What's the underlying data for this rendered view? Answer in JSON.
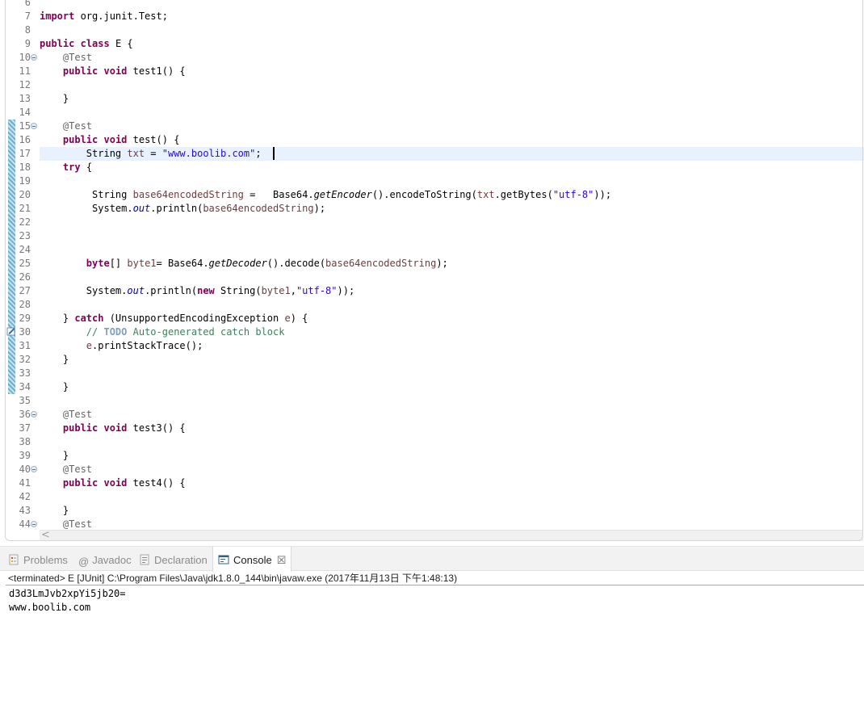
{
  "editor": {
    "lines": [
      {
        "number": "6",
        "tokens": []
      },
      {
        "number": "7",
        "tokens": [
          {
            "t": "kw",
            "v": "import"
          },
          {
            "t": "pl",
            "v": " org.junit.Test;"
          }
        ]
      },
      {
        "number": "8",
        "tokens": []
      },
      {
        "number": "9",
        "tokens": [
          {
            "t": "kw",
            "v": "public"
          },
          {
            "t": "pl",
            "v": " "
          },
          {
            "t": "kw",
            "v": "class"
          },
          {
            "t": "pl",
            "v": " E {"
          }
        ]
      },
      {
        "number": "10",
        "fold": true,
        "tokens": [
          {
            "t": "pl",
            "v": "    "
          },
          {
            "t": "ann",
            "v": "@Test"
          }
        ]
      },
      {
        "number": "11",
        "tokens": [
          {
            "t": "pl",
            "v": "    "
          },
          {
            "t": "kw",
            "v": "public"
          },
          {
            "t": "pl",
            "v": " "
          },
          {
            "t": "kw",
            "v": "void"
          },
          {
            "t": "pl",
            "v": " test1() {"
          }
        ]
      },
      {
        "number": "12",
        "tokens": []
      },
      {
        "number": "13",
        "tokens": [
          {
            "t": "pl",
            "v": "    }"
          }
        ]
      },
      {
        "number": "14",
        "tokens": []
      },
      {
        "number": "15",
        "fold": true,
        "changed": true,
        "tokens": [
          {
            "t": "pl",
            "v": "    "
          },
          {
            "t": "ann",
            "v": "@Test"
          }
        ]
      },
      {
        "number": "16",
        "changed": true,
        "tokens": [
          {
            "t": "pl",
            "v": "    "
          },
          {
            "t": "kw",
            "v": "public"
          },
          {
            "t": "pl",
            "v": " "
          },
          {
            "t": "kw",
            "v": "void"
          },
          {
            "t": "pl",
            "v": " test() {"
          }
        ]
      },
      {
        "number": "17",
        "changed": true,
        "current": true,
        "tokens": [
          {
            "t": "pl",
            "v": "        String "
          },
          {
            "t": "lv",
            "v": "txt"
          },
          {
            "t": "pl",
            "v": " = "
          },
          {
            "t": "str",
            "v": "\"www.boolib.com\""
          },
          {
            "t": "pl",
            "v": ";"
          }
        ]
      },
      {
        "number": "18",
        "changed": true,
        "tokens": [
          {
            "t": "pl",
            "v": "    "
          },
          {
            "t": "kw",
            "v": "try"
          },
          {
            "t": "pl",
            "v": " {"
          }
        ]
      },
      {
        "number": "19",
        "changed": true,
        "tokens": []
      },
      {
        "number": "20",
        "changed": true,
        "tokens": [
          {
            "t": "pl",
            "v": "         String "
          },
          {
            "t": "lv",
            "v": "base64encodedString"
          },
          {
            "t": "pl",
            "v": " =   Base64."
          },
          {
            "t": "smi",
            "v": "getEncoder"
          },
          {
            "t": "pl",
            "v": "().encodeToString("
          },
          {
            "t": "lv",
            "v": "txt"
          },
          {
            "t": "pl",
            "v": ".getBytes("
          },
          {
            "t": "str",
            "v": "\"utf-8\""
          },
          {
            "t": "pl",
            "v": "));"
          }
        ]
      },
      {
        "number": "21",
        "changed": true,
        "tokens": [
          {
            "t": "pl",
            "v": "         System."
          },
          {
            "t": "fld",
            "v": "out"
          },
          {
            "t": "pl",
            "v": ".println("
          },
          {
            "t": "lv",
            "v": "base64encodedString"
          },
          {
            "t": "pl",
            "v": ");"
          }
        ]
      },
      {
        "number": "22",
        "changed": true,
        "tokens": []
      },
      {
        "number": "23",
        "changed": true,
        "tokens": []
      },
      {
        "number": "24",
        "changed": true,
        "tokens": []
      },
      {
        "number": "25",
        "changed": true,
        "tokens": [
          {
            "t": "pl",
            "v": "        "
          },
          {
            "t": "kw",
            "v": "byte"
          },
          {
            "t": "pl",
            "v": "[] "
          },
          {
            "t": "lv",
            "v": "byte1"
          },
          {
            "t": "pl",
            "v": "= Base64."
          },
          {
            "t": "smi",
            "v": "getDecoder"
          },
          {
            "t": "pl",
            "v": "().decode("
          },
          {
            "t": "lv",
            "v": "base64encodedString"
          },
          {
            "t": "pl",
            "v": ");"
          }
        ]
      },
      {
        "number": "26",
        "changed": true,
        "tokens": []
      },
      {
        "number": "27",
        "changed": true,
        "tokens": [
          {
            "t": "pl",
            "v": "        System."
          },
          {
            "t": "fld",
            "v": "out"
          },
          {
            "t": "pl",
            "v": ".println("
          },
          {
            "t": "kw",
            "v": "new"
          },
          {
            "t": "pl",
            "v": " String("
          },
          {
            "t": "lv",
            "v": "byte1"
          },
          {
            "t": "pl",
            "v": ","
          },
          {
            "t": "str",
            "v": "\"utf-8\""
          },
          {
            "t": "pl",
            "v": "));"
          }
        ]
      },
      {
        "number": "28",
        "changed": true,
        "tokens": []
      },
      {
        "number": "29",
        "changed": true,
        "tokens": [
          {
            "t": "pl",
            "v": "    } "
          },
          {
            "t": "kw",
            "v": "catch"
          },
          {
            "t": "pl",
            "v": " (UnsupportedEncodingException "
          },
          {
            "t": "lv",
            "v": "e"
          },
          {
            "t": "pl",
            "v": ") {"
          }
        ]
      },
      {
        "number": "30",
        "changed": true,
        "task": true,
        "tokens": [
          {
            "t": "pl",
            "v": "        "
          },
          {
            "t": "cmt",
            "v": "// "
          },
          {
            "t": "todo",
            "v": "TODO"
          },
          {
            "t": "cmt",
            "v": " Auto-generated catch block"
          }
        ]
      },
      {
        "number": "31",
        "changed": true,
        "tokens": [
          {
            "t": "pl",
            "v": "        "
          },
          {
            "t": "lv",
            "v": "e"
          },
          {
            "t": "pl",
            "v": ".printStackTrace();"
          }
        ]
      },
      {
        "number": "32",
        "changed": true,
        "tokens": [
          {
            "t": "pl",
            "v": "    }"
          }
        ]
      },
      {
        "number": "33",
        "changed": true,
        "tokens": []
      },
      {
        "number": "34",
        "changed": true,
        "tokens": [
          {
            "t": "pl",
            "v": "    }"
          }
        ]
      },
      {
        "number": "35",
        "tokens": []
      },
      {
        "number": "36",
        "fold": true,
        "tokens": [
          {
            "t": "pl",
            "v": "    "
          },
          {
            "t": "ann",
            "v": "@Test"
          }
        ]
      },
      {
        "number": "37",
        "tokens": [
          {
            "t": "pl",
            "v": "    "
          },
          {
            "t": "kw",
            "v": "public"
          },
          {
            "t": "pl",
            "v": " "
          },
          {
            "t": "kw",
            "v": "void"
          },
          {
            "t": "pl",
            "v": " test3() {"
          }
        ]
      },
      {
        "number": "38",
        "tokens": []
      },
      {
        "number": "39",
        "tokens": [
          {
            "t": "pl",
            "v": "    }"
          }
        ]
      },
      {
        "number": "40",
        "fold": true,
        "tokens": [
          {
            "t": "pl",
            "v": "    "
          },
          {
            "t": "ann",
            "v": "@Test"
          }
        ]
      },
      {
        "number": "41",
        "tokens": [
          {
            "t": "pl",
            "v": "    "
          },
          {
            "t": "kw",
            "v": "public"
          },
          {
            "t": "pl",
            "v": " "
          },
          {
            "t": "kw",
            "v": "void"
          },
          {
            "t": "pl",
            "v": " test4() {"
          }
        ]
      },
      {
        "number": "42",
        "tokens": []
      },
      {
        "number": "43",
        "tokens": [
          {
            "t": "pl",
            "v": "    }"
          }
        ]
      },
      {
        "number": "44",
        "fold": true,
        "tokens": [
          {
            "t": "pl",
            "v": "    "
          },
          {
            "t": "ann",
            "v": "@Test"
          }
        ]
      }
    ],
    "scroll_left_label": "<"
  },
  "panel": {
    "tabs": [
      {
        "label": "Problems",
        "icon": "problems-icon",
        "active": false
      },
      {
        "label": "Javadoc",
        "icon": "at-sign-icon",
        "active": false
      },
      {
        "label": "Declaration",
        "icon": "declaration-icon",
        "active": false
      },
      {
        "label": "Console",
        "icon": "console-icon",
        "active": true
      }
    ],
    "close_glyph": "☒",
    "at_glyph": "@",
    "console": {
      "header": "<terminated> E [JUnit] C:\\Program Files\\Java\\jdk1.8.0_144\\bin\\javaw.exe (2017年11月13日 下午1:48:13)",
      "output": [
        "d3d3LmJvb2xpYi5jb20=",
        "www.boolib.com"
      ]
    }
  },
  "colors": {
    "keyword": "#7f0055",
    "string": "#2a00ff",
    "field": "#0000c0",
    "comment": "#3f7f5f",
    "annotation": "#646464",
    "current_line": "#e8f2fe"
  }
}
